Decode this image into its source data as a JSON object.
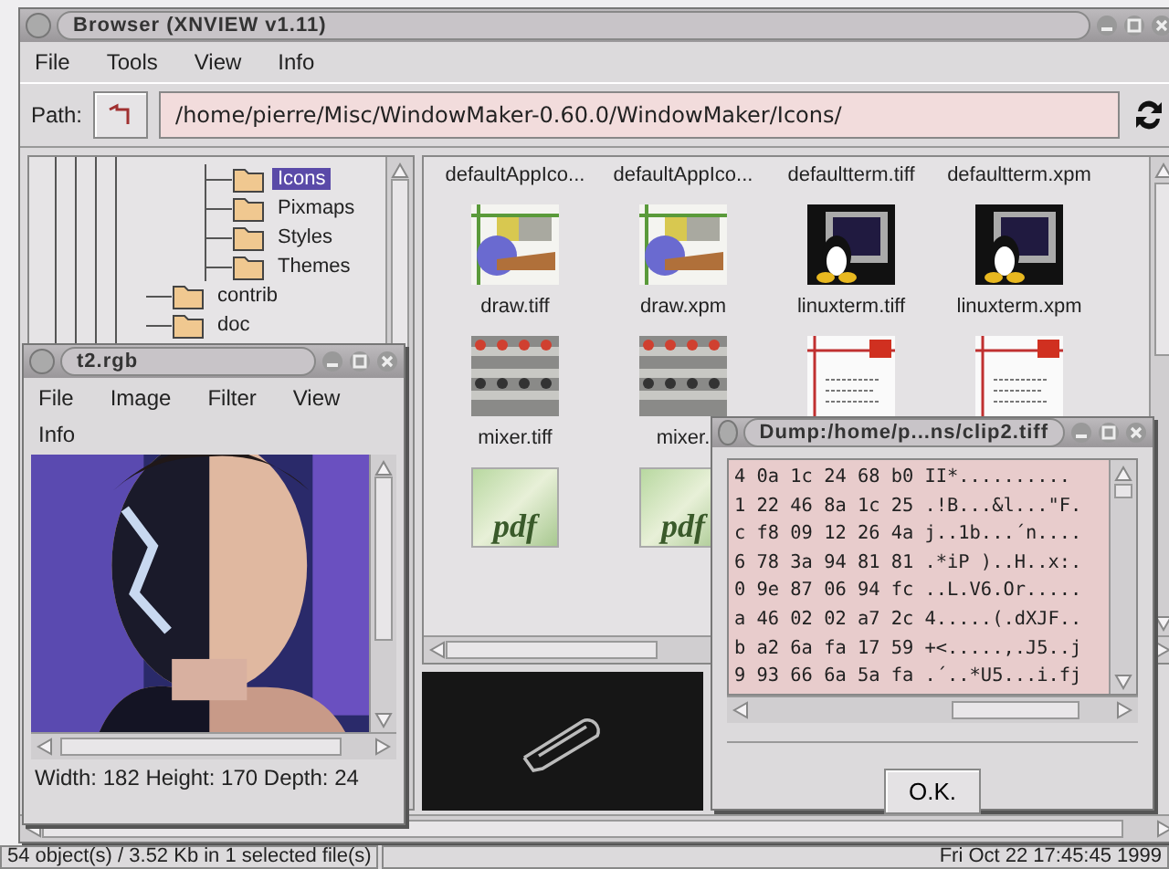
{
  "browser": {
    "title": "Browser (XNVIEW v1.11)",
    "menu": [
      "File",
      "Tools",
      "View",
      "Info"
    ],
    "path": {
      "label": "Path:",
      "value": "/home/pierre/Misc/WindowMaker-0.60.0/WindowMaker/Icons/"
    },
    "tree": [
      {
        "children": [
          {
            "label": "Icons",
            "selected": true
          },
          {
            "label": "Pixmaps",
            "selected": false
          },
          {
            "label": "Styles",
            "selected": false
          },
          {
            "label": "Themes",
            "selected": false
          }
        ]
      },
      {
        "label": "contrib",
        "selected": false
      },
      {
        "label": "doc",
        "selected": false
      }
    ],
    "files": [
      {
        "label": "defaultAppIco..."
      },
      {
        "label": "defaultAppIco..."
      },
      {
        "label": "defaultterm.tiff"
      },
      {
        "label": "defaultterm.xpm"
      },
      {
        "kind": "draw",
        "label": "draw.tiff"
      },
      {
        "kind": "draw",
        "label": "draw.xpm"
      },
      {
        "kind": "terminal",
        "label": "linuxterm.tiff"
      },
      {
        "kind": "terminal",
        "label": "linuxterm.xpm"
      },
      {
        "kind": "mixer",
        "label": "mixer.tiff"
      },
      {
        "kind": "mixer",
        "label": "mixer."
      },
      {
        "kind": "document"
      },
      {
        "kind": "document"
      },
      {
        "kind": "pdf",
        "icon_text": "pdf"
      },
      {
        "kind": "pdf",
        "icon_text": "pdf"
      }
    ],
    "status": {
      "info": "54 object(s) / 3.52 Kb in 1 selected file(s)",
      "clock": "Fri Oct 22 17:45:45 1999"
    }
  },
  "image_window": {
    "title": "t2.rgb",
    "menu": [
      "File",
      "Image",
      "Filter",
      "View",
      "Info"
    ],
    "status": "Width: 182  Height: 170  Depth: 24"
  },
  "dump_window": {
    "title": "Dump:/home/p...ns/clip2.tiff",
    "lines": [
      "4 0a 1c 24 68 b0 II*..........",
      "1 22 46 8a 1c 25 .!B...&l...\"F.",
      "c f8 09 12 26 4a j..1b...´n....",
      "6 78 3a 94 81 81 .*iP )..H..x:.",
      "0 9e 87 06 94 fc ..L.V6.Or.....",
      "a 46 02 02 a7 2c 4.....(.dXJF..",
      "b a2 6a fa 17 59 +<.....,.J5..j",
      "9 93 66 6a 5a fa .´..*U5...i.fj"
    ],
    "button": "O.K."
  }
}
